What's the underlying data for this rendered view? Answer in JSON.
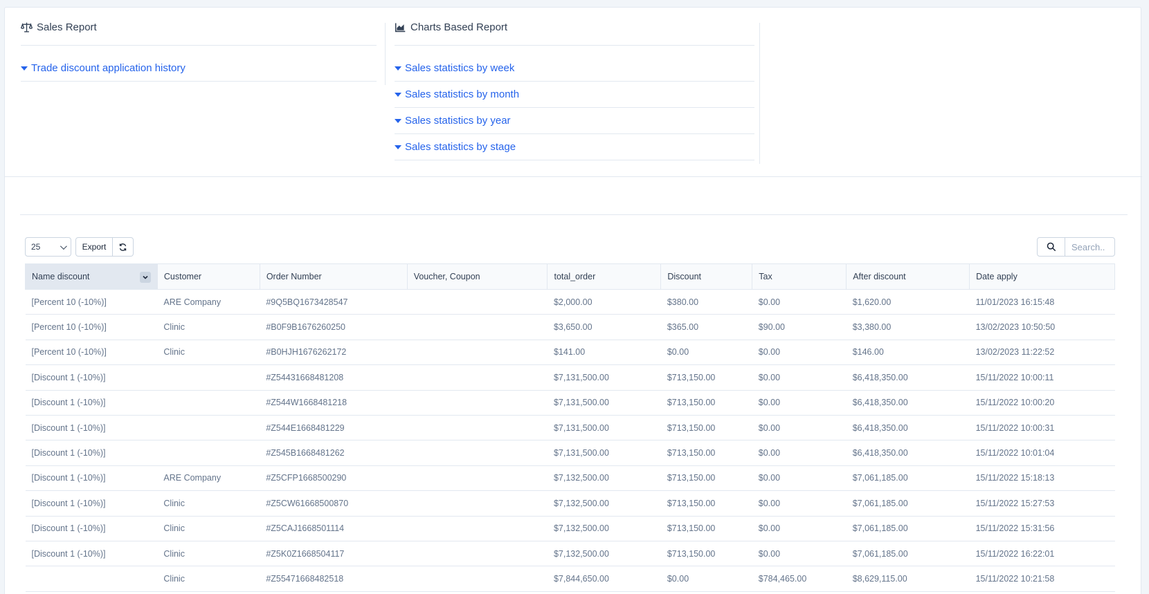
{
  "sales_report": {
    "title": "Sales Report",
    "icon": "scale-icon",
    "links": [
      "Trade discount application history"
    ]
  },
  "charts_report": {
    "title": "Charts Based Report",
    "icon": "area-chart-icon",
    "links": [
      "Sales statistics by week",
      "Sales statistics by month",
      "Sales statistics by year",
      "Sales statistics by stage"
    ]
  },
  "toolbar": {
    "page_size": "25",
    "export_label": "Export",
    "search_placeholder": "Search.."
  },
  "table": {
    "columns": [
      "Name discount",
      "Customer",
      "Order Number",
      "Voucher, Coupon",
      "total_order",
      "Discount",
      "Tax",
      "After discount",
      "Date apply"
    ],
    "rows": [
      [
        "[Percent 10 (-10%)]",
        "ARE Company",
        "#9Q5BQ1673428547",
        "",
        "$2,000.00",
        "$380.00",
        "$0.00",
        "$1,620.00",
        "11/01/2023 16:15:48"
      ],
      [
        "[Percent 10 (-10%)]",
        "Clinic",
        "#B0F9B1676260250",
        "",
        "$3,650.00",
        "$365.00",
        "$90.00",
        "$3,380.00",
        "13/02/2023 10:50:50"
      ],
      [
        "[Percent 10 (-10%)]",
        "Clinic",
        "#B0HJH1676262172",
        "",
        "$141.00",
        "$0.00",
        "$0.00",
        "$146.00",
        "13/02/2023 11:22:52"
      ],
      [
        "[Discount 1 (-10%)]",
        "",
        "#Z54431668481208",
        "",
        "$7,131,500.00",
        "$713,150.00",
        "$0.00",
        "$6,418,350.00",
        "15/11/2022 10:00:11"
      ],
      [
        "[Discount 1 (-10%)]",
        "",
        "#Z544W1668481218",
        "",
        "$7,131,500.00",
        "$713,150.00",
        "$0.00",
        "$6,418,350.00",
        "15/11/2022 10:00:20"
      ],
      [
        "[Discount 1 (-10%)]",
        "",
        "#Z544E1668481229",
        "",
        "$7,131,500.00",
        "$713,150.00",
        "$0.00",
        "$6,418,350.00",
        "15/11/2022 10:00:31"
      ],
      [
        "[Discount 1 (-10%)]",
        "",
        "#Z545B1668481262",
        "",
        "$7,131,500.00",
        "$713,150.00",
        "$0.00",
        "$6,418,350.00",
        "15/11/2022 10:01:04"
      ],
      [
        "[Discount 1 (-10%)]",
        "ARE Company",
        "#Z5CFP1668500290",
        "",
        "$7,132,500.00",
        "$713,150.00",
        "$0.00",
        "$7,061,185.00",
        "15/11/2022 15:18:13"
      ],
      [
        "[Discount 1 (-10%)]",
        "Clinic",
        "#Z5CW61668500870",
        "",
        "$7,132,500.00",
        "$713,150.00",
        "$0.00",
        "$7,061,185.00",
        "15/11/2022 15:27:53"
      ],
      [
        "[Discount 1 (-10%)]",
        "Clinic",
        "#Z5CAJ1668501114",
        "",
        "$7,132,500.00",
        "$713,150.00",
        "$0.00",
        "$7,061,185.00",
        "15/11/2022 15:31:56"
      ],
      [
        "[Discount 1 (-10%)]",
        "Clinic",
        "#Z5K0Z1668504117",
        "",
        "$7,132,500.00",
        "$713,150.00",
        "$0.00",
        "$7,061,185.00",
        "15/11/2022 16:22:01"
      ],
      [
        "",
        "Clinic",
        "#Z55471668482518",
        "",
        "$7,844,650.00",
        "$0.00",
        "$784,465.00",
        "$8,629,115.00",
        "15/11/2022 10:21:58"
      ]
    ]
  }
}
